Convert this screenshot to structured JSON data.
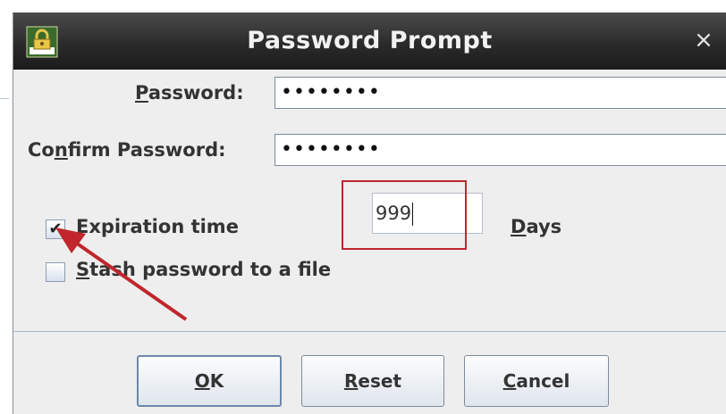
{
  "dialog": {
    "title": "Password Prompt",
    "close_glyph": "×",
    "icon": "lock-keyring-icon"
  },
  "password": {
    "label_mnemonic": "P",
    "label_rest": "assword:",
    "value": "••••••••"
  },
  "confirm_password": {
    "label_before": "Co",
    "label_mnemonic": "n",
    "label_after": "firm Password:",
    "value": "••••••••"
  },
  "expiration": {
    "checked": true,
    "check_glyph": "✔",
    "label": "Expiration time",
    "days_value": "999",
    "days_label_mnemonic": "D",
    "days_label_rest": "ays"
  },
  "stash": {
    "checked": false,
    "label_mnemonic": "S",
    "label_rest": "tash password to a file"
  },
  "buttons": {
    "ok_mnemonic": "O",
    "ok_rest": "K",
    "reset_mnemonic": "R",
    "reset_rest": "eset",
    "cancel_mnemonic": "C",
    "cancel_rest": "ancel"
  },
  "annotations": {
    "highlight_color": "#c0262c",
    "arrow_color": "#c0262c"
  }
}
